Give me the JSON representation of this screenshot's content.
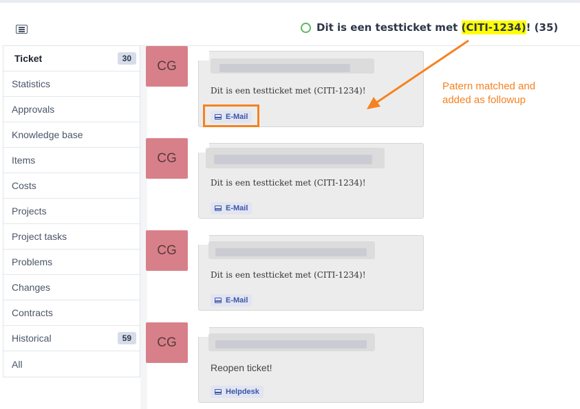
{
  "header": {
    "title_prefix": "Dit is een testticket met ",
    "title_highlight": "(CITI-1234)",
    "title_suffix": "! (35)",
    "status_color": "#5cb85c"
  },
  "sidebar": {
    "items": [
      {
        "label": "Ticket",
        "count": "30"
      },
      {
        "label": "Statistics",
        "count": ""
      },
      {
        "label": "Approvals",
        "count": ""
      },
      {
        "label": "Knowledge base",
        "count": ""
      },
      {
        "label": "Items",
        "count": ""
      },
      {
        "label": "Costs",
        "count": ""
      },
      {
        "label": "Projects",
        "count": ""
      },
      {
        "label": "Project tasks",
        "count": ""
      },
      {
        "label": "Problems",
        "count": ""
      },
      {
        "label": "Changes",
        "count": ""
      },
      {
        "label": "Contracts",
        "count": ""
      },
      {
        "label": "Historical",
        "count": "59"
      },
      {
        "label": "All",
        "count": ""
      }
    ]
  },
  "timeline": [
    {
      "avatar": "CG",
      "text": "Dit is een testticket met (CITI-1234)!",
      "source": "E-Mail"
    },
    {
      "avatar": "CG",
      "text": "Dit is een testticket met (CITI-1234)!",
      "source": "E-Mail"
    },
    {
      "avatar": "CG",
      "text": "Dit is een testticket met (CITI-1234)!",
      "source": "E-Mail"
    },
    {
      "avatar": "CG",
      "text": "Reopen ticket!",
      "source": "Helpdesk"
    }
  ],
  "annotation": {
    "line1": "Patern matched and",
    "line2": "added as followup",
    "color": "#f58220"
  },
  "colors": {
    "avatar_bg": "#d88089",
    "tag_text": "#3a56a8",
    "highlight": "#ffff00"
  },
  "icons": [
    "menu-icon",
    "status-circle-icon",
    "inbox-icon"
  ]
}
